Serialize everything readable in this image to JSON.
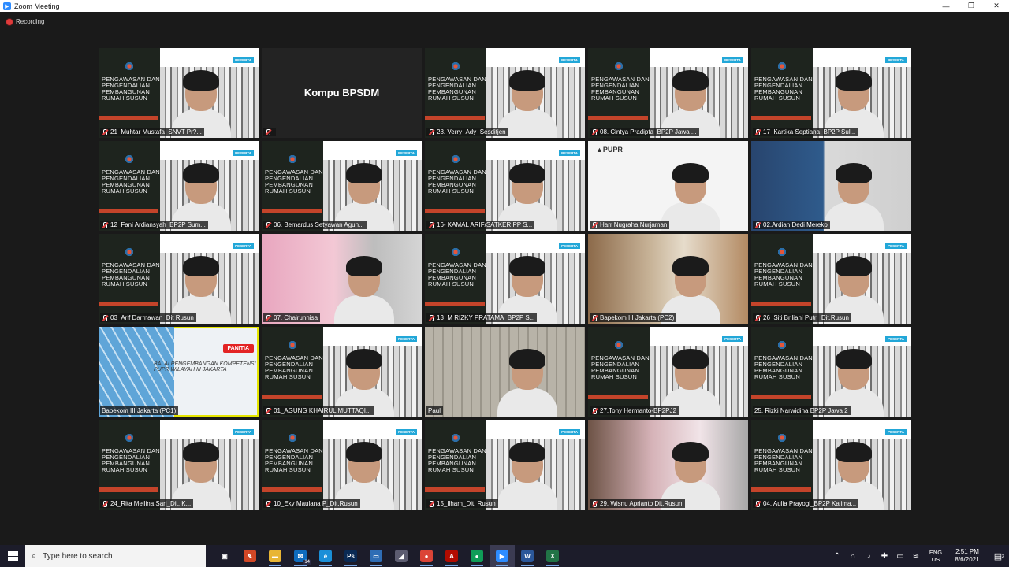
{
  "window": {
    "title": "Zoom Meeting",
    "controls": [
      "—",
      "❐",
      "✕"
    ]
  },
  "recording_label": "Recording",
  "poster": {
    "title_lines": [
      "PENGAWASAN DAN",
      "PENGENDALIAN",
      "PEMBANGUNAN",
      "RUMAH SUSUN"
    ],
    "badge": "PESERTA"
  },
  "tiles": [
    {
      "name": "21_Muhtar Mustafa_SNVT Pr?...",
      "bg": "poster",
      "muted": true
    },
    {
      "name": "",
      "bg": "black",
      "big_name": "Kompu BPSDM",
      "muted": true
    },
    {
      "name": "28. Verry_Ady_Sesditjen",
      "bg": "poster",
      "muted": true
    },
    {
      "name": "08. Cintya Pradipta_BP2P Jawa ...",
      "bg": "poster",
      "muted": true
    },
    {
      "name": "17_Kartika Septiana_BP2P Sul...",
      "bg": "poster",
      "muted": true
    },
    {
      "name": "12_Fani Ardiansyah_BP2P Sum...",
      "bg": "poster",
      "muted": true
    },
    {
      "name": "06. Bernardus Setyawan Agun...",
      "bg": "poster",
      "muted": true
    },
    {
      "name": "16- KAMAL ARIF/SATKER PP S...",
      "bg": "poster",
      "muted": true
    },
    {
      "name": "Harr Nugraha Nurjaman",
      "bg": "pupr",
      "muted": true
    },
    {
      "name": "02.Ardian Dedi Mereko",
      "bg": "blue",
      "muted": true
    },
    {
      "name": "03_Arif Darmawan_Dit Rusun",
      "bg": "poster",
      "muted": true
    },
    {
      "name": "07. Chairunnisa",
      "bg": "pink",
      "muted": true
    },
    {
      "name": "13_M RIZKY PRATAMA_BP2P S...",
      "bg": "poster",
      "muted": true
    },
    {
      "name": "Bapekom III Jakarta (PC2)",
      "bg": "room",
      "muted": true
    },
    {
      "name": "26_Siti Briliani Putri_Dit.Rusun",
      "bg": "poster",
      "muted": true
    },
    {
      "name": "Bapekom III Jakarta (PC1)",
      "bg": "kompu",
      "muted": false,
      "active": true,
      "panitia": "PANITIA",
      "slide_text": "BALAI PENGEMBANGAN KOMPETENSI PUPR WILAYAH III JAKARTA"
    },
    {
      "name": "01_AGUNG KHAIRUL MUTTAQI...",
      "bg": "poster",
      "muted": true
    },
    {
      "name": "Paul",
      "bg": "tower",
      "muted": false
    },
    {
      "name": "27.Tony Hermanto-BP2PJ2",
      "bg": "poster",
      "muted": true
    },
    {
      "name": "25. Rizki Narwidina BP2P Jawa 2",
      "bg": "poster",
      "muted": false
    },
    {
      "name": "24_Rita Meilina Sari_Dit. K...",
      "bg": "poster",
      "muted": true
    },
    {
      "name": "10_Eky Maulana P_Dit.Rusun",
      "bg": "poster",
      "muted": true
    },
    {
      "name": "15_Ilham_Dit. Rusun",
      "bg": "poster",
      "muted": true
    },
    {
      "name": "29. Wisnu Aprianto Dit.Rusun",
      "bg": "cherry",
      "muted": true
    },
    {
      "name": "04. Aulia Prayogi_BP2P Kalima...",
      "bg": "poster",
      "muted": true
    }
  ],
  "taskbar": {
    "search_placeholder": "Type here to search",
    "apps": [
      {
        "icon": "task-view-icon",
        "glyph": "▣",
        "color": "#1c1c2a"
      },
      {
        "icon": "pen-app-icon",
        "glyph": "✎",
        "color": "#d24726"
      },
      {
        "icon": "file-explorer-icon",
        "glyph": "▬",
        "color": "#e8b534"
      },
      {
        "icon": "mail-icon",
        "glyph": "✉",
        "color": "#0f6cbd",
        "badge": "14"
      },
      {
        "icon": "edge-icon",
        "glyph": "e",
        "color": "#1a8fd8"
      },
      {
        "icon": "photoshop-icon",
        "glyph": "Ps",
        "color": "#0a2a54"
      },
      {
        "icon": "remote-desktop-icon",
        "glyph": "▭",
        "color": "#2f6db5"
      },
      {
        "icon": "app-icon",
        "glyph": "◢",
        "color": "#5c5c70"
      },
      {
        "icon": "chrome-icon",
        "glyph": "●",
        "color": "#db4437"
      },
      {
        "icon": "acrobat-icon",
        "glyph": "A",
        "color": "#b30b00"
      },
      {
        "icon": "chrome-profile-icon",
        "glyph": "●",
        "color": "#0f9d58"
      },
      {
        "icon": "zoom-icon",
        "glyph": "▶",
        "color": "#2d8cff"
      },
      {
        "icon": "word-icon",
        "glyph": "W",
        "color": "#2b579a"
      },
      {
        "icon": "excel-icon",
        "glyph": "X",
        "color": "#217346"
      }
    ],
    "tray": {
      "lang_top": "ENG",
      "lang_bottom": "US",
      "time": "2:51 PM",
      "date": "8/6/2021",
      "notifications": "3"
    }
  }
}
